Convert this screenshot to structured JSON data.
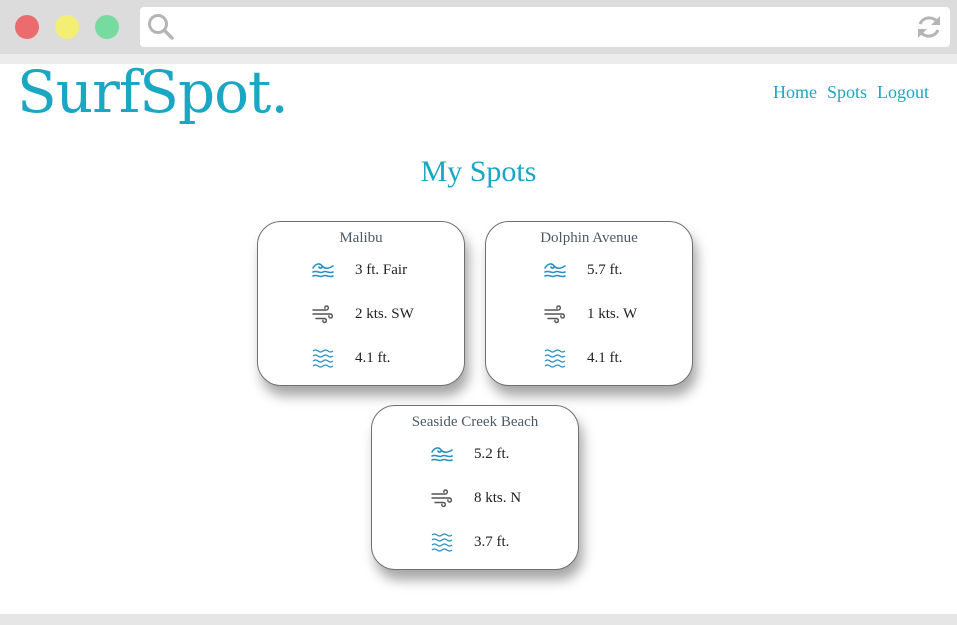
{
  "brand": {
    "logo": "SurfSpot."
  },
  "nav": {
    "home": "Home",
    "spots": "Spots",
    "logout": "Logout"
  },
  "page": {
    "heading": "My Spots"
  },
  "icons": {
    "swell": "waves-swell-icon",
    "wind": "wind-icon",
    "tide": "water-lines-icon"
  },
  "colors": {
    "accent": "#1aa7c4",
    "icon_blue": "#2a8fc0"
  },
  "spots": [
    {
      "name": "Malibu",
      "swell": "3 ft. Fair",
      "wind": "2 kts. SW",
      "tide": "4.1 ft."
    },
    {
      "name": "Dolphin Avenue",
      "swell": "5.7 ft.",
      "wind": "1 kts. W",
      "tide": "4.1 ft."
    },
    {
      "name": "Seaside Creek Beach",
      "swell": "5.2 ft.",
      "wind": "8 kts. N",
      "tide": "3.7 ft."
    }
  ]
}
